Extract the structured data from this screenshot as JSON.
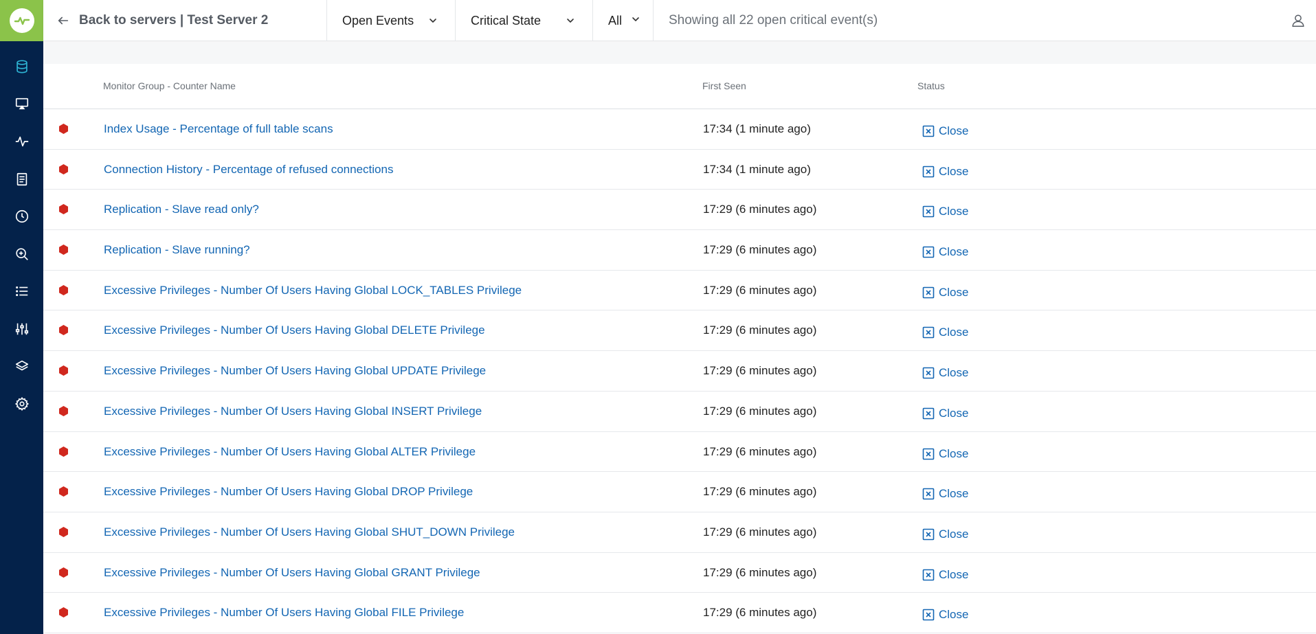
{
  "colors": {
    "sidebar": "#04224a",
    "logo_bg": "#8bc34a",
    "link": "#1366b3",
    "critical": "#d0281e",
    "active_nav": "#2eb6d6"
  },
  "sidebar": {
    "items": [
      {
        "icon": "database-icon",
        "active": true
      },
      {
        "icon": "monitor-icon",
        "active": false
      },
      {
        "icon": "pulse-icon",
        "active": false
      },
      {
        "icon": "document-icon",
        "active": false
      },
      {
        "icon": "clock-icon",
        "active": false
      },
      {
        "icon": "zoom-in-icon",
        "active": false
      },
      {
        "icon": "list-icon",
        "active": false
      },
      {
        "icon": "sliders-icon",
        "active": false
      },
      {
        "icon": "layers-icon",
        "active": false
      },
      {
        "icon": "gear-icon",
        "active": false
      }
    ]
  },
  "header": {
    "back_label": "Back to servers | Test Server 2",
    "filters": {
      "events": "Open Events",
      "state": "Critical State",
      "scope": "All"
    },
    "showing": "Showing all 22 open critical event(s)"
  },
  "table": {
    "columns": {
      "name": "Monitor Group - Counter Name",
      "first_seen": "First Seen",
      "status": "Status"
    },
    "rows": [
      {
        "name": "Index Usage - Percentage of full table scans",
        "first_seen": "17:34 (1 minute ago)",
        "status": "Close"
      },
      {
        "name": "Connection History - Percentage of refused connections",
        "first_seen": "17:34 (1 minute ago)",
        "status": "Close"
      },
      {
        "name": "Replication - Slave read only?",
        "first_seen": "17:29 (6 minutes ago)",
        "status": "Close"
      },
      {
        "name": "Replication - Slave running?",
        "first_seen": "17:29 (6 minutes ago)",
        "status": "Close"
      },
      {
        "name": "Excessive Privileges - Number Of Users Having Global LOCK_TABLES Privilege",
        "first_seen": "17:29 (6 minutes ago)",
        "status": "Close"
      },
      {
        "name": "Excessive Privileges - Number Of Users Having Global DELETE Privilege",
        "first_seen": "17:29 (6 minutes ago)",
        "status": "Close"
      },
      {
        "name": "Excessive Privileges - Number Of Users Having Global UPDATE Privilege",
        "first_seen": "17:29 (6 minutes ago)",
        "status": "Close"
      },
      {
        "name": "Excessive Privileges - Number Of Users Having Global INSERT Privilege",
        "first_seen": "17:29 (6 minutes ago)",
        "status": "Close"
      },
      {
        "name": "Excessive Privileges - Number Of Users Having Global ALTER Privilege",
        "first_seen": "17:29 (6 minutes ago)",
        "status": "Close"
      },
      {
        "name": "Excessive Privileges - Number Of Users Having Global DROP Privilege",
        "first_seen": "17:29 (6 minutes ago)",
        "status": "Close"
      },
      {
        "name": "Excessive Privileges - Number Of Users Having Global SHUT_DOWN Privilege",
        "first_seen": "17:29 (6 minutes ago)",
        "status": "Close"
      },
      {
        "name": "Excessive Privileges - Number Of Users Having Global GRANT Privilege",
        "first_seen": "17:29 (6 minutes ago)",
        "status": "Close"
      },
      {
        "name": "Excessive Privileges - Number Of Users Having Global FILE Privilege",
        "first_seen": "17:29 (6 minutes ago)",
        "status": "Close"
      }
    ]
  }
}
